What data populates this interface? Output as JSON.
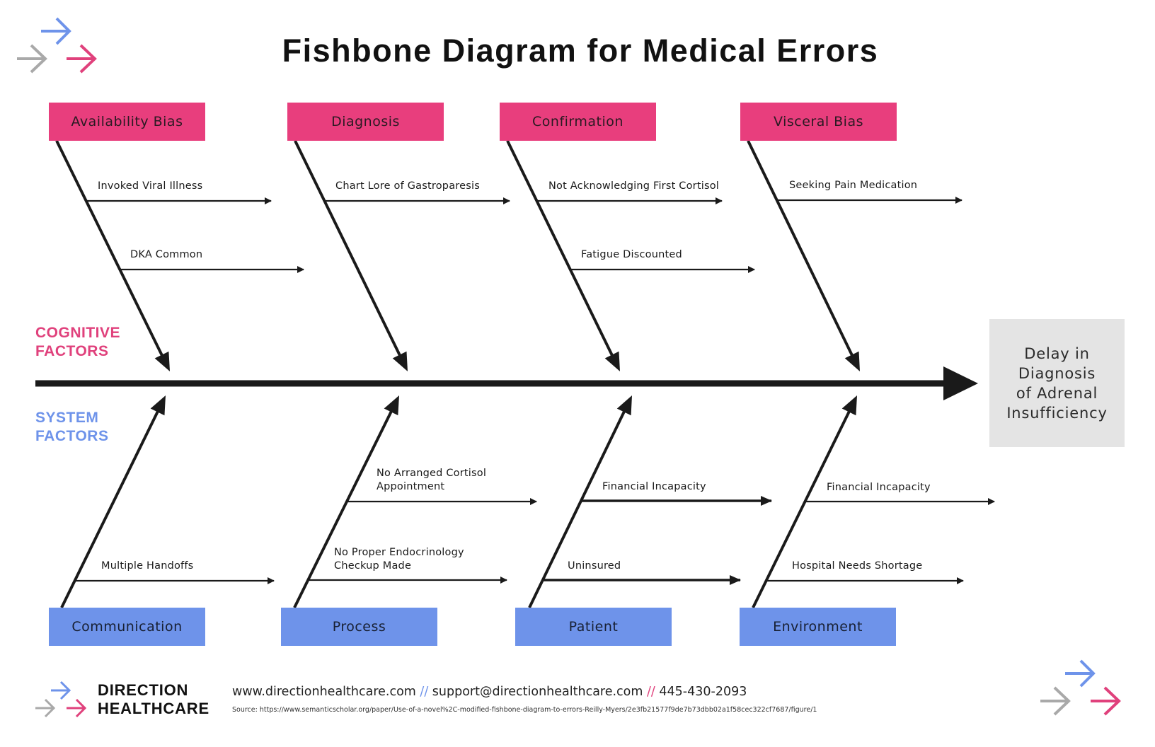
{
  "title": "Fishbone Diagram for Medical Errors",
  "effect": {
    "lines": [
      "Delay in",
      "Diagnosis",
      "of Adrenal",
      "Insufficiency"
    ]
  },
  "side_labels": {
    "top": [
      "COGNITIVE",
      "FACTORS"
    ],
    "bottom": [
      "SYSTEM",
      "FACTORS"
    ]
  },
  "colors": {
    "cognitive": "#e83e7d",
    "system": "#6e93ea",
    "effect_bg": "#e4e4e4",
    "spine": "#1a1a1a",
    "logo_gray": "#a9a9a9"
  },
  "categories_top": [
    {
      "label": "Availability Bias",
      "causes": [
        "Invoked Viral Illness",
        "DKA Common"
      ]
    },
    {
      "label": "Diagnosis",
      "causes": [
        "Chart Lore of Gastroparesis"
      ]
    },
    {
      "label": "Confirmation",
      "causes": [
        "Not Acknowledging First Cortisol",
        "Fatigue Discounted"
      ]
    },
    {
      "label": "Visceral Bias",
      "causes": [
        "Seeking Pain Medication"
      ]
    }
  ],
  "categories_bottom": [
    {
      "label": "Communication",
      "causes": [
        "Multiple Handoffs"
      ]
    },
    {
      "label": "Process",
      "causes": [
        "No Arranged Cortisol Appointment",
        "No Proper Endocrinology Checkup Made"
      ],
      "cause_lines": [
        [
          "No Arranged Cortisol",
          "Appointment"
        ],
        [
          "No Proper Endocrinology",
          "Checkup Made"
        ]
      ]
    },
    {
      "label": "Patient",
      "causes": [
        "Financial Incapacity",
        "Uninsured"
      ]
    },
    {
      "label": "Environment",
      "causes": [
        "Financial Incapacity",
        "Hospital Needs Shortage"
      ]
    }
  ],
  "footer": {
    "brand_lines": [
      "DIRECTION",
      "HEALTHCARE"
    ],
    "website": "www.directionhealthcare.com",
    "separator": "//",
    "email": "support@directionhealthcare.com",
    "phone": "445-430-2093",
    "source": "Source: https://www.semanticscholar.org/paper/Use-of-a-novel%2C-modified-fishbone-diagram-to-errors-Reilly-Myers/2e3fb21577f9de7b73dbb02a1f58cec322cf7687/figure/1"
  }
}
